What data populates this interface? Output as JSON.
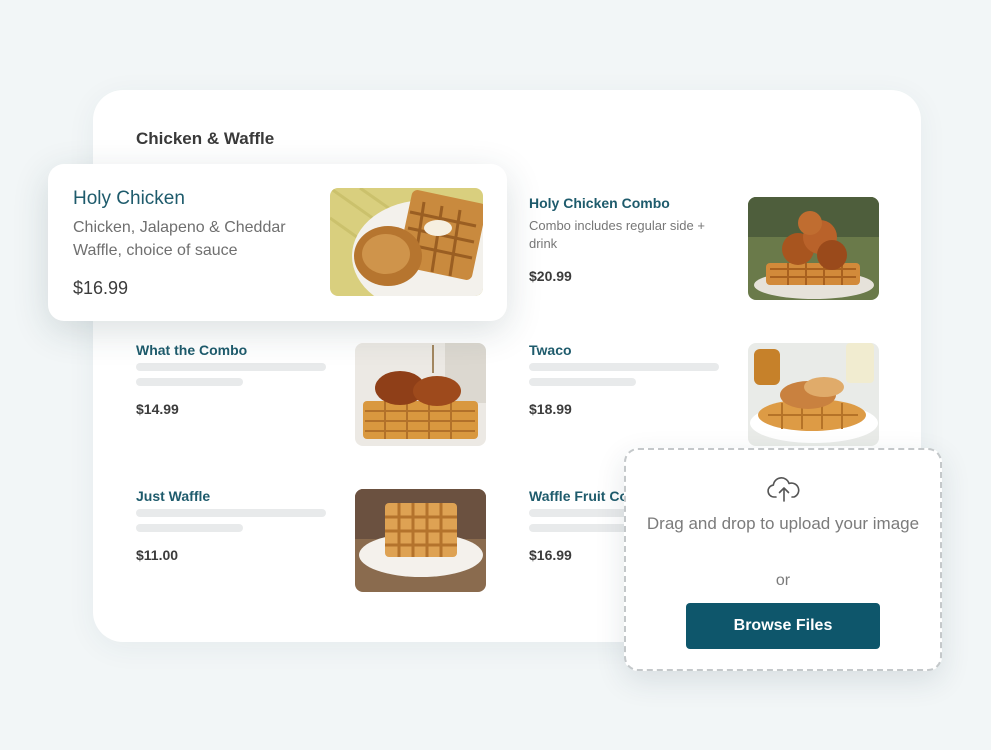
{
  "section": {
    "title": "Chicken & Waffle"
  },
  "featured": {
    "name": "Holy Chicken",
    "description": "Chicken, Jalapeno & Cheddar Waffle, choice of sauce",
    "price": "$16.99"
  },
  "items": [
    {
      "name": "Holy Chicken Combo",
      "description": "Combo includes regular side + drink",
      "price": "$20.99"
    },
    {
      "name": "What the Combo",
      "price": "$14.99"
    },
    {
      "name": "Twaco",
      "price": "$18.99"
    },
    {
      "name": "Just Waffle",
      "price": "$11.00"
    },
    {
      "name": "Waffle Fruit Combo",
      "price": "$16.99"
    }
  ],
  "upload": {
    "icon": "cloud-upload-icon",
    "prompt": "Drag and drop to upload your image",
    "or": "or",
    "button": "Browse Files"
  },
  "colors": {
    "accent": "#0e566b",
    "item_name": "#1e5b6c",
    "background": "#f2f6f7"
  }
}
